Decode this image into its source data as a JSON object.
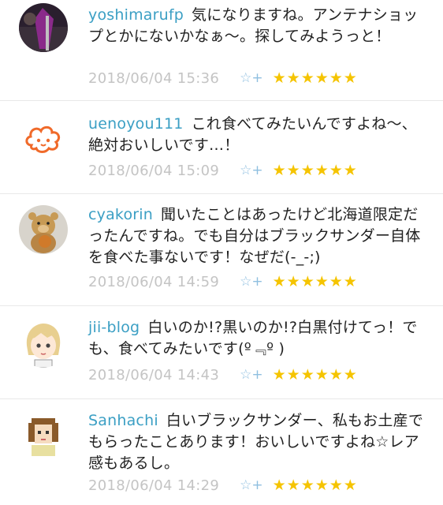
{
  "comments": [
    {
      "user": "yoshimarufp",
      "text": "気になりますね。アンテナショップとかにないかなぁ〜。探してみようっと！",
      "date": "2018/06/04 15:36",
      "star_add_icon": "☆+",
      "stars": "★★★★★★"
    },
    {
      "user": "uenoyou111",
      "text": "これ食べてみたいんですよね〜、絶対おいしいです…！",
      "date": "2018/06/04 15:09",
      "star_add_icon": "☆+",
      "stars": "★★★★★★"
    },
    {
      "user": "cyakorin",
      "text": "聞いたことはあったけど北海道限定だったんですね。でも自分はブラックサンダー自体を食べた事ないです！なぜだ(-_-;)",
      "date": "2018/06/04 14:59",
      "star_add_icon": "☆+",
      "stars": "★★★★★★"
    },
    {
      "user": "jii-blog",
      "text": "白いのか!?黒いのか!?白黒付けてっ！でも、食べてみたいです(º﹃º )",
      "date": "2018/06/04 14:43",
      "star_add_icon": "☆+",
      "stars": "★★★★★★"
    },
    {
      "user": "Sanhachi",
      "text": "白いブラックサンダー、私もお土産でもらったことあります！おいしいですよね☆レア感もあるし。",
      "date": "2018/06/04 14:29",
      "star_add_icon": "☆+",
      "stars": "★★★★★★"
    }
  ]
}
